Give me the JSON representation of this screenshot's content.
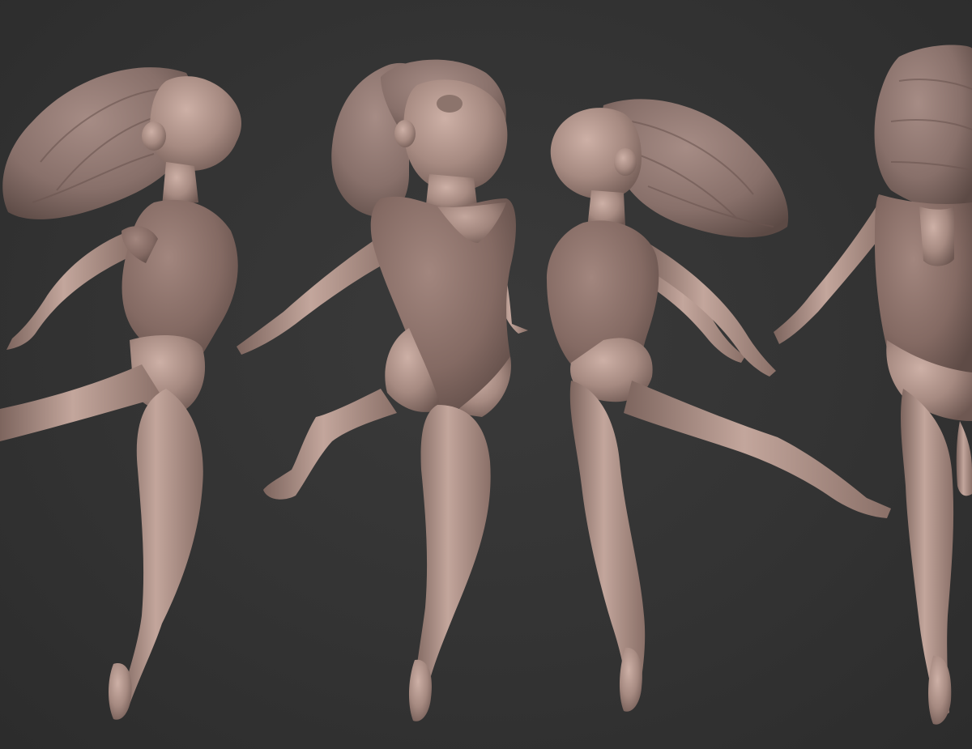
{
  "scene": {
    "background_color": "#323232",
    "skin_color": "#a98d84",
    "skin_highlight": "#c9aca2",
    "skin_shadow": "#7a625b",
    "leotard_color": "#8c716a",
    "hair_color": "#8f7670",
    "figures": [
      {
        "id": "figure-1",
        "view": "side-right"
      },
      {
        "id": "figure-2",
        "view": "front-three-quarter"
      },
      {
        "id": "figure-3",
        "view": "side-left"
      },
      {
        "id": "figure-4",
        "view": "back"
      }
    ]
  }
}
